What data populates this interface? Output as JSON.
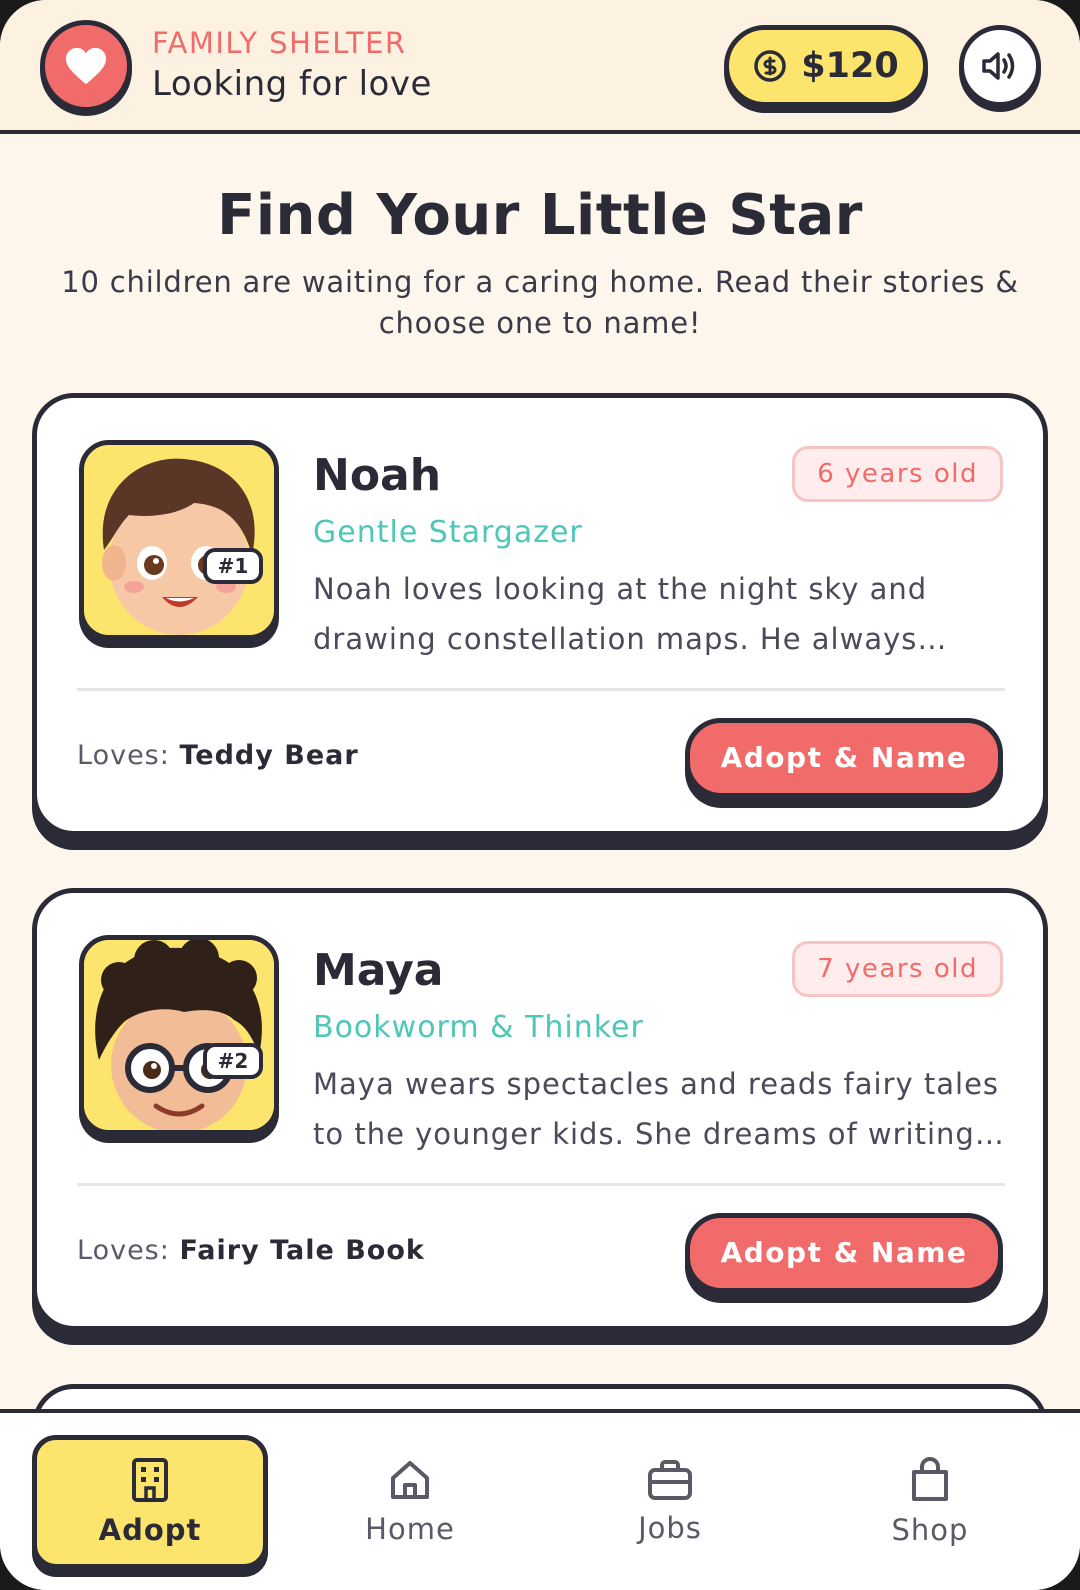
{
  "header": {
    "kicker": "FAMILY SHELTER",
    "title": "Looking for love",
    "coins": "$120"
  },
  "intro": {
    "title": "Find Your Little Star",
    "subtitle": "10 children are waiting for a caring home. Read their stories & choose one to name!"
  },
  "children": [
    {
      "badge": "#1",
      "name": "Noah",
      "age": "6 years old",
      "tagline": "Gentle Stargazer",
      "story": "Noah loves looking at the night sky and drawing constellation maps. He always…",
      "loves_label": "Loves:",
      "loves": "Teddy Bear",
      "button": "Adopt & Name"
    },
    {
      "badge": "#2",
      "name": "Maya",
      "age": "7 years old",
      "tagline": "Bookworm & Thinker",
      "story": "Maya wears spectacles and reads fairy tales to the younger kids. She dreams of writing…",
      "loves_label": "Loves:",
      "loves": "Fairy Tale Book",
      "button": "Adopt & Name"
    }
  ],
  "nav": [
    {
      "label": "Adopt",
      "icon": "building-icon",
      "active": true
    },
    {
      "label": "Home",
      "icon": "home-icon",
      "active": false
    },
    {
      "label": "Jobs",
      "icon": "briefcase-icon",
      "active": false
    },
    {
      "label": "Shop",
      "icon": "shopping-bag-icon",
      "active": false
    }
  ],
  "colors": {
    "accent": "#f26b6b",
    "yellow": "#fde56d",
    "teal": "#4dc7b8",
    "ink": "#2b2b38",
    "background": "#fdf6ec"
  }
}
